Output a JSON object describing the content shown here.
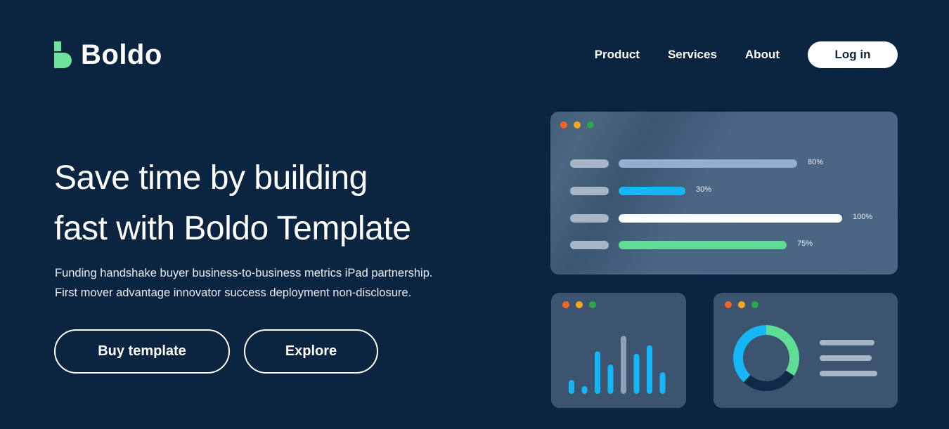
{
  "brand": {
    "name": "Boldo",
    "color": "#6ee39b"
  },
  "nav": {
    "links": [
      "Product",
      "Services",
      "About"
    ],
    "login_label": "Log in"
  },
  "hero": {
    "title_lines": [
      "Save time by building",
      "fast with Boldo Template"
    ],
    "description_lines": [
      "Funding handshake buyer business-to-business metrics iPad partnership.",
      "First mover advantage innovator success deployment non-disclosure."
    ],
    "buy_label": "Buy template",
    "explore_label": "Explore"
  },
  "window_dots": [
    "#f26522",
    "#f4a71d",
    "#2aa84a"
  ],
  "progress_card": {
    "rows": [
      {
        "percent": 80,
        "label": "80%",
        "color": "#8fb0d0"
      },
      {
        "percent": 30,
        "label": "30%",
        "color": "#15b6f5"
      },
      {
        "percent": 100,
        "label": "100%",
        "color": "#ffffff"
      },
      {
        "percent": 75,
        "label": "75%",
        "color": "#5fdc95"
      }
    ]
  },
  "bars_card": {
    "bars": [
      {
        "value": 0.18,
        "color": "#15b6f5"
      },
      {
        "value": 0.1,
        "color": "#15b6f5"
      },
      {
        "value": 0.55,
        "color": "#15b6f5"
      },
      {
        "value": 0.38,
        "color": "#15b6f5"
      },
      {
        "value": 0.75,
        "color": "#8ea3b8"
      },
      {
        "value": 0.52,
        "color": "#15b6f5"
      },
      {
        "value": 0.63,
        "color": "#15b6f5"
      },
      {
        "value": 0.28,
        "color": "#15b6f5"
      }
    ]
  },
  "donut_card": {
    "segments": [
      {
        "fraction": 0.34,
        "color": "#5fdc95"
      },
      {
        "fraction": 0.28,
        "color": "#0f2a47"
      },
      {
        "fraction": 0.38,
        "color": "#15b6f5"
      }
    ],
    "legend_lines": 3
  }
}
